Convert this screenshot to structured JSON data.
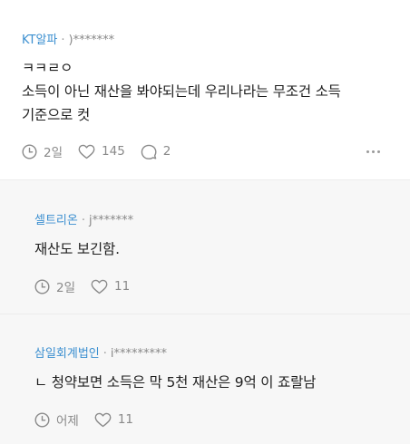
{
  "comments": [
    {
      "author": "KT알파",
      "separator": "·",
      "user_id": ")*******",
      "lines": [
        "ㅋㅋㄹㅇ",
        "소득이 아닌 재산을 봐야되는데 우리나라는 무조건 소득",
        "기준으로 컷"
      ],
      "time": "2일",
      "likes": "145",
      "replies": "2"
    }
  ],
  "replies": [
    {
      "author": "셀트리온",
      "separator": "·",
      "user_id": "j*******",
      "text": "재산도 보긴함.",
      "time": "2일",
      "likes": "11"
    },
    {
      "author": "삼일회계법인",
      "separator": "·",
      "user_id": "i*********",
      "text": "ㄴ 청약보면 소득은 막 5천 재산은 9억 이 죠랄남",
      "time": "어제",
      "likes": "11"
    }
  ],
  "icons": {
    "time": "clock-icon",
    "like": "heart-icon",
    "reply": "speech-bubble-icon",
    "more": "more-dots-icon"
  },
  "colors": {
    "author": "#3b8fd0",
    "reply_background": "#f7f7f7",
    "meta_text": "#8a8a8a"
  }
}
